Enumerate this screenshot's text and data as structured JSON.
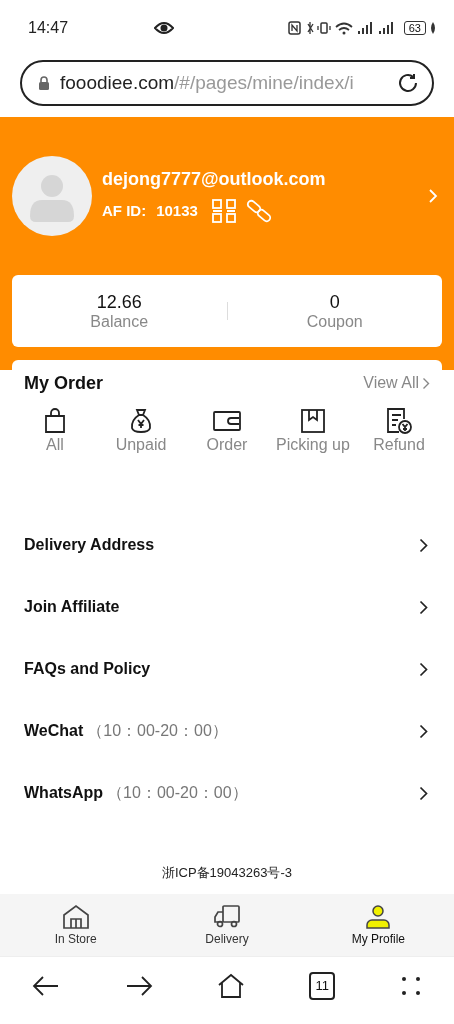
{
  "status_bar": {
    "time": "14:47",
    "battery": "63"
  },
  "address_bar": {
    "domain": "fooodiee.com",
    "path": "/#/pages/mine/index/i"
  },
  "profile": {
    "email": "dejong7777@outlook.com",
    "af_id_label": "AF ID:",
    "af_id": "10133"
  },
  "stats": [
    {
      "value": "12.66",
      "label": "Balance"
    },
    {
      "value": "0",
      "label": "Coupon"
    }
  ],
  "my_order": {
    "title": "My Order",
    "view_all": "View All",
    "items": [
      {
        "kind": "bag",
        "label": "All"
      },
      {
        "kind": "money-bag",
        "label": "Unpaid"
      },
      {
        "kind": "wallet",
        "label": "Order"
      },
      {
        "kind": "box",
        "label": "Picking up"
      },
      {
        "kind": "receipt",
        "label": "Refund"
      }
    ]
  },
  "menu": [
    {
      "label": "Delivery Address"
    },
    {
      "label": "Join Affiliate"
    },
    {
      "label": "FAQs and Policy"
    },
    {
      "label": "WeChat",
      "hours": "（10：00-20：00）"
    },
    {
      "label": "WhatsApp",
      "hours": "（10：00-20：00）"
    }
  ],
  "footer": "浙ICP备19043263号-3",
  "tabs": [
    {
      "kind": "store",
      "label": "In Store",
      "selected": false
    },
    {
      "kind": "truck",
      "label": "Delivery",
      "selected": false
    },
    {
      "kind": "person",
      "label": "My Profile",
      "selected": true
    }
  ],
  "browser_nav": {
    "tab_count": "11"
  }
}
